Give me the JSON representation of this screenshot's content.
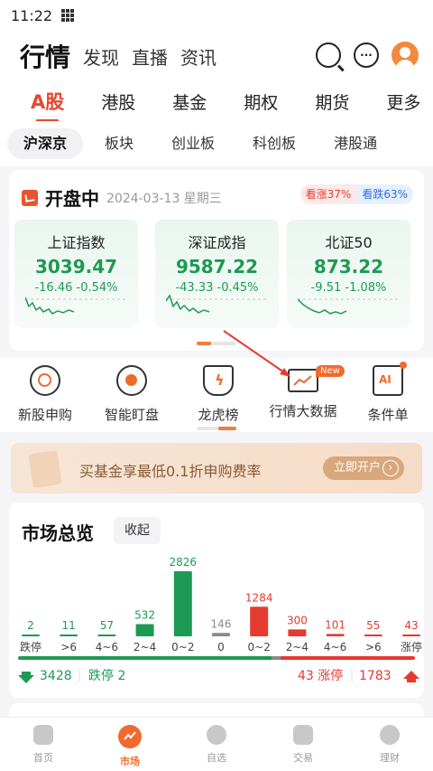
{
  "status_bar": {
    "time": "11:22"
  },
  "top_nav": {
    "tabs": [
      "行情",
      "发现",
      "直播",
      "资讯"
    ]
  },
  "market_tabs": [
    "A股",
    "港股",
    "基金",
    "期权",
    "期货",
    "更多"
  ],
  "sub_tabs": [
    "沪深京",
    "板块",
    "创业板",
    "科创板",
    "港股通"
  ],
  "session": {
    "status": "开盘中",
    "date": "2024-03-13 星期三",
    "up_ratio": "看涨37%",
    "down_ratio": "看跌63%"
  },
  "indices": [
    {
      "name": "上证指数",
      "price": "3039.47",
      "change": "-16.46",
      "pct": "-0.54%"
    },
    {
      "name": "深证成指",
      "price": "9587.22",
      "change": "-43.33",
      "pct": "-0.45%"
    },
    {
      "name": "北证50",
      "price": "873.22",
      "change": "-9.51",
      "pct": "-1.08%"
    }
  ],
  "tools": [
    {
      "label": "新股申购",
      "icon": "target-icon"
    },
    {
      "label": "智能盯盘",
      "icon": "radar-icon"
    },
    {
      "label": "龙虎榜",
      "icon": "lightning-shield-icon"
    },
    {
      "label": "行情大数据",
      "icon": "monitor-chart-icon",
      "badge": "New"
    },
    {
      "label": "条件单",
      "icon": "ai-calendar-icon"
    }
  ],
  "banner": {
    "text": "买基金享最低0.1折申购费率",
    "button": "立即开户"
  },
  "overview": {
    "title": "市场总览",
    "collapse": "收起",
    "down_total": "3428",
    "limit_down": "跌停 2",
    "limit_up": "43 涨停",
    "up_total": "1783"
  },
  "chart_data": {
    "type": "bar",
    "categories": [
      "跌停",
      ">6",
      "4~6",
      "2~4",
      "0~2",
      "0",
      "0~2",
      "2~4",
      "4~6",
      ">6",
      "涨停"
    ],
    "values": [
      2,
      11,
      57,
      532,
      2826,
      146,
      1284,
      300,
      101,
      55,
      43
    ],
    "colors": [
      "#1d9a53",
      "#1d9a53",
      "#1d9a53",
      "#1d9a53",
      "#1d9a53",
      "#8a8a8a",
      "#e53a30",
      "#e53a30",
      "#e53a30",
      "#e53a30",
      "#e53a30"
    ],
    "title": "",
    "xlabel": "",
    "ylabel": ""
  },
  "bottom_nav": [
    "首页",
    "市场",
    "自选",
    "交易",
    "理财"
  ],
  "colors": {
    "accent": "#f06a2e",
    "up": "#e53a30",
    "down": "#1d9a53"
  }
}
